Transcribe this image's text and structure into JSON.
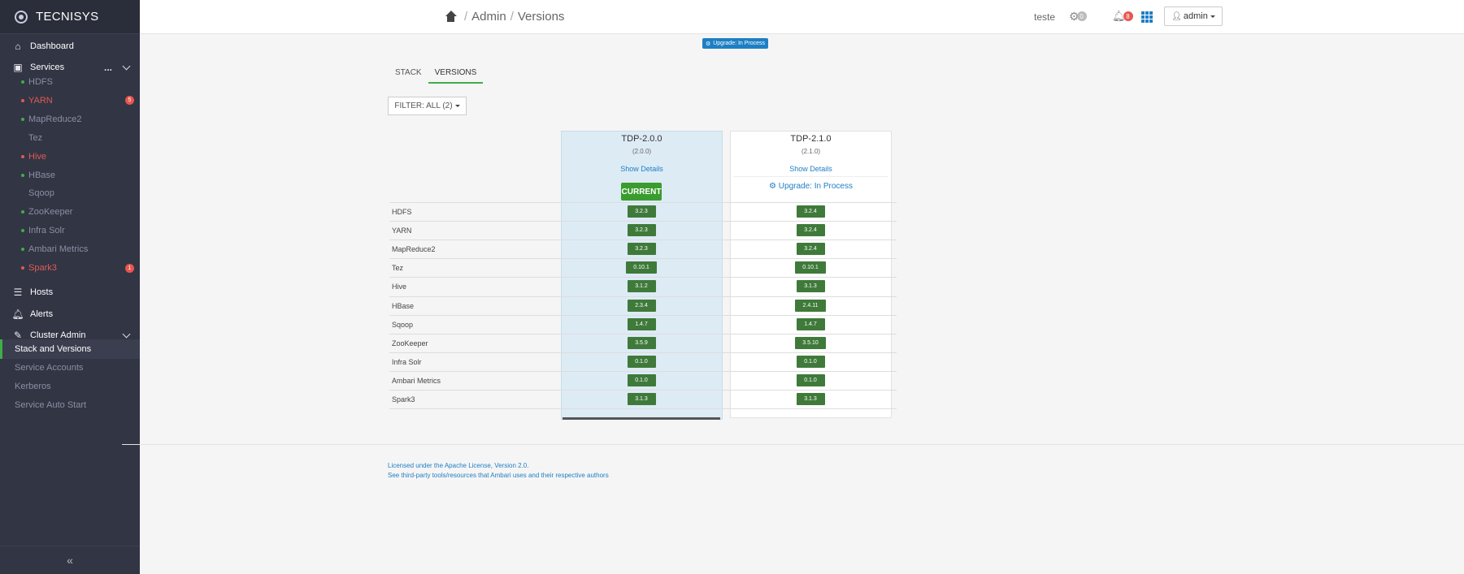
{
  "app": {
    "brand": "TECNISYS"
  },
  "sidebar": {
    "dashboard": "Dashboard",
    "services": "Services",
    "services_more": "...",
    "service_items": [
      {
        "name": "HDFS",
        "status": "green",
        "badge": ""
      },
      {
        "name": "YARN",
        "status": "red",
        "badge": "5"
      },
      {
        "name": "MapReduce2",
        "status": "green",
        "badge": ""
      },
      {
        "name": "Tez",
        "status": "none",
        "badge": ""
      },
      {
        "name": "Hive",
        "status": "red",
        "badge": ""
      },
      {
        "name": "HBase",
        "status": "green",
        "badge": ""
      },
      {
        "name": "Sqoop",
        "status": "none",
        "badge": ""
      },
      {
        "name": "ZooKeeper",
        "status": "green",
        "badge": ""
      },
      {
        "name": "Infra Solr",
        "status": "green",
        "badge": ""
      },
      {
        "name": "Ambari Metrics",
        "status": "green",
        "badge": ""
      },
      {
        "name": "Spark3",
        "status": "red",
        "badge": "1"
      }
    ],
    "hosts": "Hosts",
    "alerts": "Alerts",
    "cluster_admin": "Cluster Admin",
    "cluster_items": [
      "Stack and Versions",
      "Service Accounts",
      "Kerberos",
      "Service Auto Start"
    ],
    "collapse": "«"
  },
  "topbar": {
    "crumb_admin": "Admin",
    "crumb_versions": "Versions",
    "sep": "/",
    "cluster_name": "teste",
    "ops_count": "0",
    "alerts_count": "8",
    "user": "admin"
  },
  "main": {
    "upgrade_banner": "Upgrade: In Process",
    "tabs": [
      "STACK",
      "VERSIONS"
    ],
    "filter": "FILTER: ALL (2)",
    "versions": [
      {
        "name": "TDP-2.0.0",
        "sub": "(2.0.0)",
        "details": "Show Details",
        "state": "CURRENT"
      },
      {
        "name": "TDP-2.1.0",
        "sub": "(2.1.0)",
        "details": "Show Details",
        "state": "Upgrade: In Process"
      }
    ],
    "rows": [
      {
        "service": "HDFS",
        "v1": "3.2.3",
        "v2": "3.2.4"
      },
      {
        "service": "YARN",
        "v1": "3.2.3",
        "v2": "3.2.4"
      },
      {
        "service": "MapReduce2",
        "v1": "3.2.3",
        "v2": "3.2.4"
      },
      {
        "service": "Tez",
        "v1": "0.10.1",
        "v2": "0.10.1"
      },
      {
        "service": "Hive",
        "v1": "3.1.2",
        "v2": "3.1.3"
      },
      {
        "service": "HBase",
        "v1": "2.3.4",
        "v2": "2.4.11"
      },
      {
        "service": "Sqoop",
        "v1": "1.4.7",
        "v2": "1.4.7"
      },
      {
        "service": "ZooKeeper",
        "v1": "3.5.9",
        "v2": "3.5.10"
      },
      {
        "service": "Infra Solr",
        "v1": "0.1.0",
        "v2": "0.1.0"
      },
      {
        "service": "Ambari Metrics",
        "v1": "0.1.0",
        "v2": "0.1.0"
      },
      {
        "service": "Spark3",
        "v1": "3.1.3",
        "v2": "3.1.3"
      }
    ]
  },
  "footer": {
    "license": "Licensed under the Apache License, Version 2.0.",
    "third_party": "See third-party tools/resources that Ambari uses and their respective authors"
  },
  "colors": {
    "accent": "#3fae49",
    "link": "#1e7fc4",
    "alert_red": "#e05a55",
    "sidebar_bg": "#323544"
  }
}
